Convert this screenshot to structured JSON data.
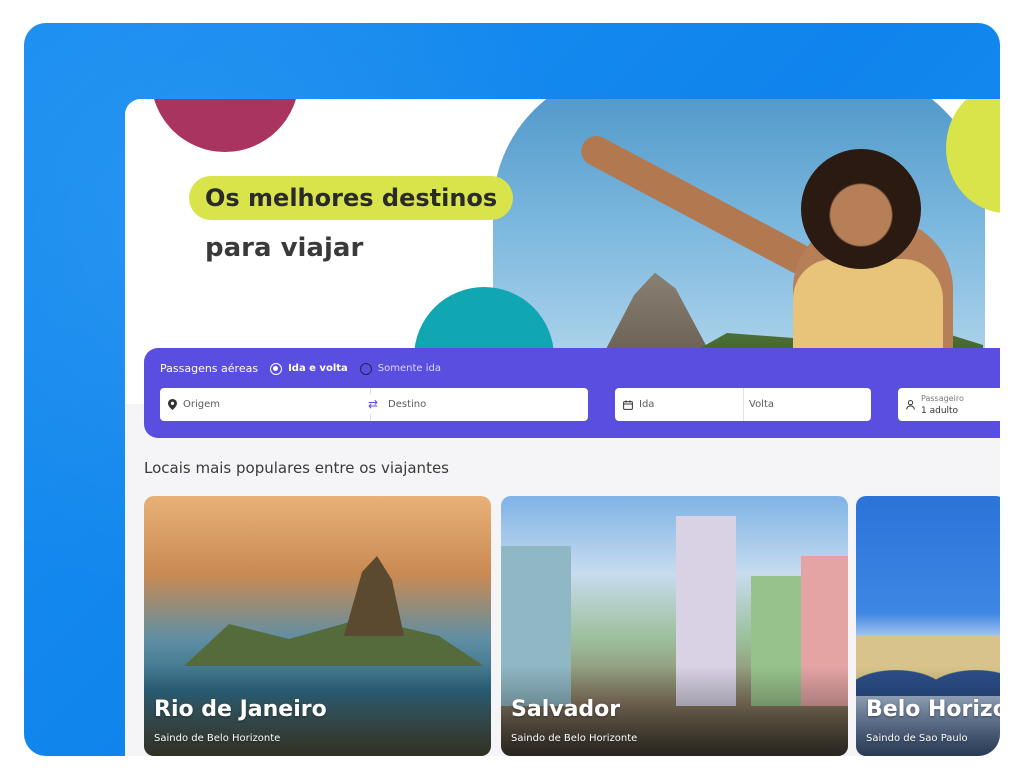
{
  "hero": {
    "title_highlight": "Os melhores destinos",
    "subtitle": "para viajar"
  },
  "search": {
    "section_label": "Passagens aéreas",
    "trip_types": [
      {
        "label": "Ida e volta",
        "selected": true
      },
      {
        "label": "Somente ida",
        "selected": false
      }
    ],
    "origin_placeholder": "Origem",
    "destination_placeholder": "Destino",
    "departure_placeholder": "Ida",
    "return_placeholder": "Volta",
    "passengers_label": "Passageiro",
    "passengers_value": "1 adulto"
  },
  "popular": {
    "title": "Locais mais populares entre os viajantes",
    "cards": [
      {
        "city": "Rio de Janeiro",
        "origin": "Saindo de Belo Horizonte"
      },
      {
        "city": "Salvador",
        "origin": "Saindo de Belo Horizonte"
      },
      {
        "city": "Belo Horizonte",
        "origin": "Saindo de Sao Paulo"
      }
    ]
  },
  "colors": {
    "frame_blue": "#1a8ff0",
    "search_purple": "#5a4ee0",
    "lime": "#d8e44a",
    "magenta": "#a8345f",
    "teal": "#11a7b2"
  },
  "icons": {
    "origin": "location-pin-icon",
    "swap": "swap-arrows-icon",
    "calendar": "calendar-icon",
    "passenger": "person-icon"
  }
}
